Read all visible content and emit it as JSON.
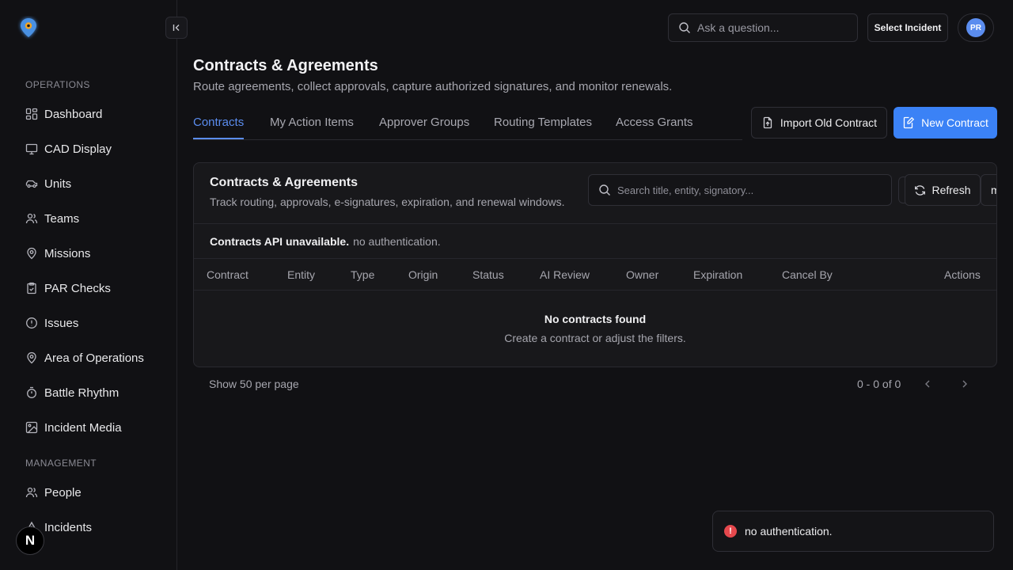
{
  "app": {
    "accent": "#3b82f6",
    "logo_color": "#4a90e2"
  },
  "sidebar": {
    "sections": [
      {
        "label": "OPERATIONS"
      },
      {
        "label": "MANAGEMENT"
      }
    ],
    "items": [
      {
        "label": "Dashboard",
        "icon": "dashboard-icon"
      },
      {
        "label": "CAD Display",
        "icon": "monitor-icon"
      },
      {
        "label": "Units",
        "icon": "vehicle-icon"
      },
      {
        "label": "Teams",
        "icon": "users-icon"
      },
      {
        "label": "Missions",
        "icon": "map-pin-icon"
      },
      {
        "label": "PAR Checks",
        "icon": "clipboard-check-icon"
      },
      {
        "label": "Issues",
        "icon": "alert-circle-icon"
      },
      {
        "label": "Area of Operations",
        "icon": "map-pin-icon"
      },
      {
        "label": "Battle Rhythm",
        "icon": "timer-icon"
      },
      {
        "label": "Incident Media",
        "icon": "image-icon"
      },
      {
        "label": "People",
        "icon": "users-icon"
      },
      {
        "label": "Incidents",
        "icon": "alert-triangle-icon"
      }
    ],
    "next_badge": "N"
  },
  "topbar": {
    "search_placeholder": "Ask a question...",
    "select_incident": "Select Incident",
    "avatar_initials": "PR"
  },
  "header": {
    "title": "Contracts & Agreements",
    "subtitle": "Route agreements, collect approvals, capture authorized signatures, and monitor renewals."
  },
  "tabs": [
    {
      "label": "Contracts",
      "active": true
    },
    {
      "label": "My Action Items"
    },
    {
      "label": "Approver Groups"
    },
    {
      "label": "Routing Templates"
    },
    {
      "label": "Access Grants"
    }
  ],
  "actions": {
    "import_label": "Import Old Contract",
    "new_label": "New Contract"
  },
  "card": {
    "title": "Contracts & Agreements",
    "subtitle": "Track routing, approvals, e-signatures, expiration, and renewal windows.",
    "search_placeholder": "Search title, entity, signatory...",
    "refresh_label": "Refresh",
    "more_label": "m",
    "alert_strong": "Contracts API unavailable.",
    "alert_text": "no authentication.",
    "columns": [
      "Contract",
      "Entity",
      "Type",
      "Origin",
      "Status",
      "AI Review",
      "Owner",
      "Expiration",
      "Cancel By",
      "Actions"
    ],
    "empty_title": "No contracts found",
    "empty_subtitle": "Create a contract or adjust the filters."
  },
  "pagination": {
    "per_page": "Show 50 per page",
    "range": "0 - 0 of 0"
  },
  "toast": {
    "icon": "!",
    "message": "no authentication."
  }
}
